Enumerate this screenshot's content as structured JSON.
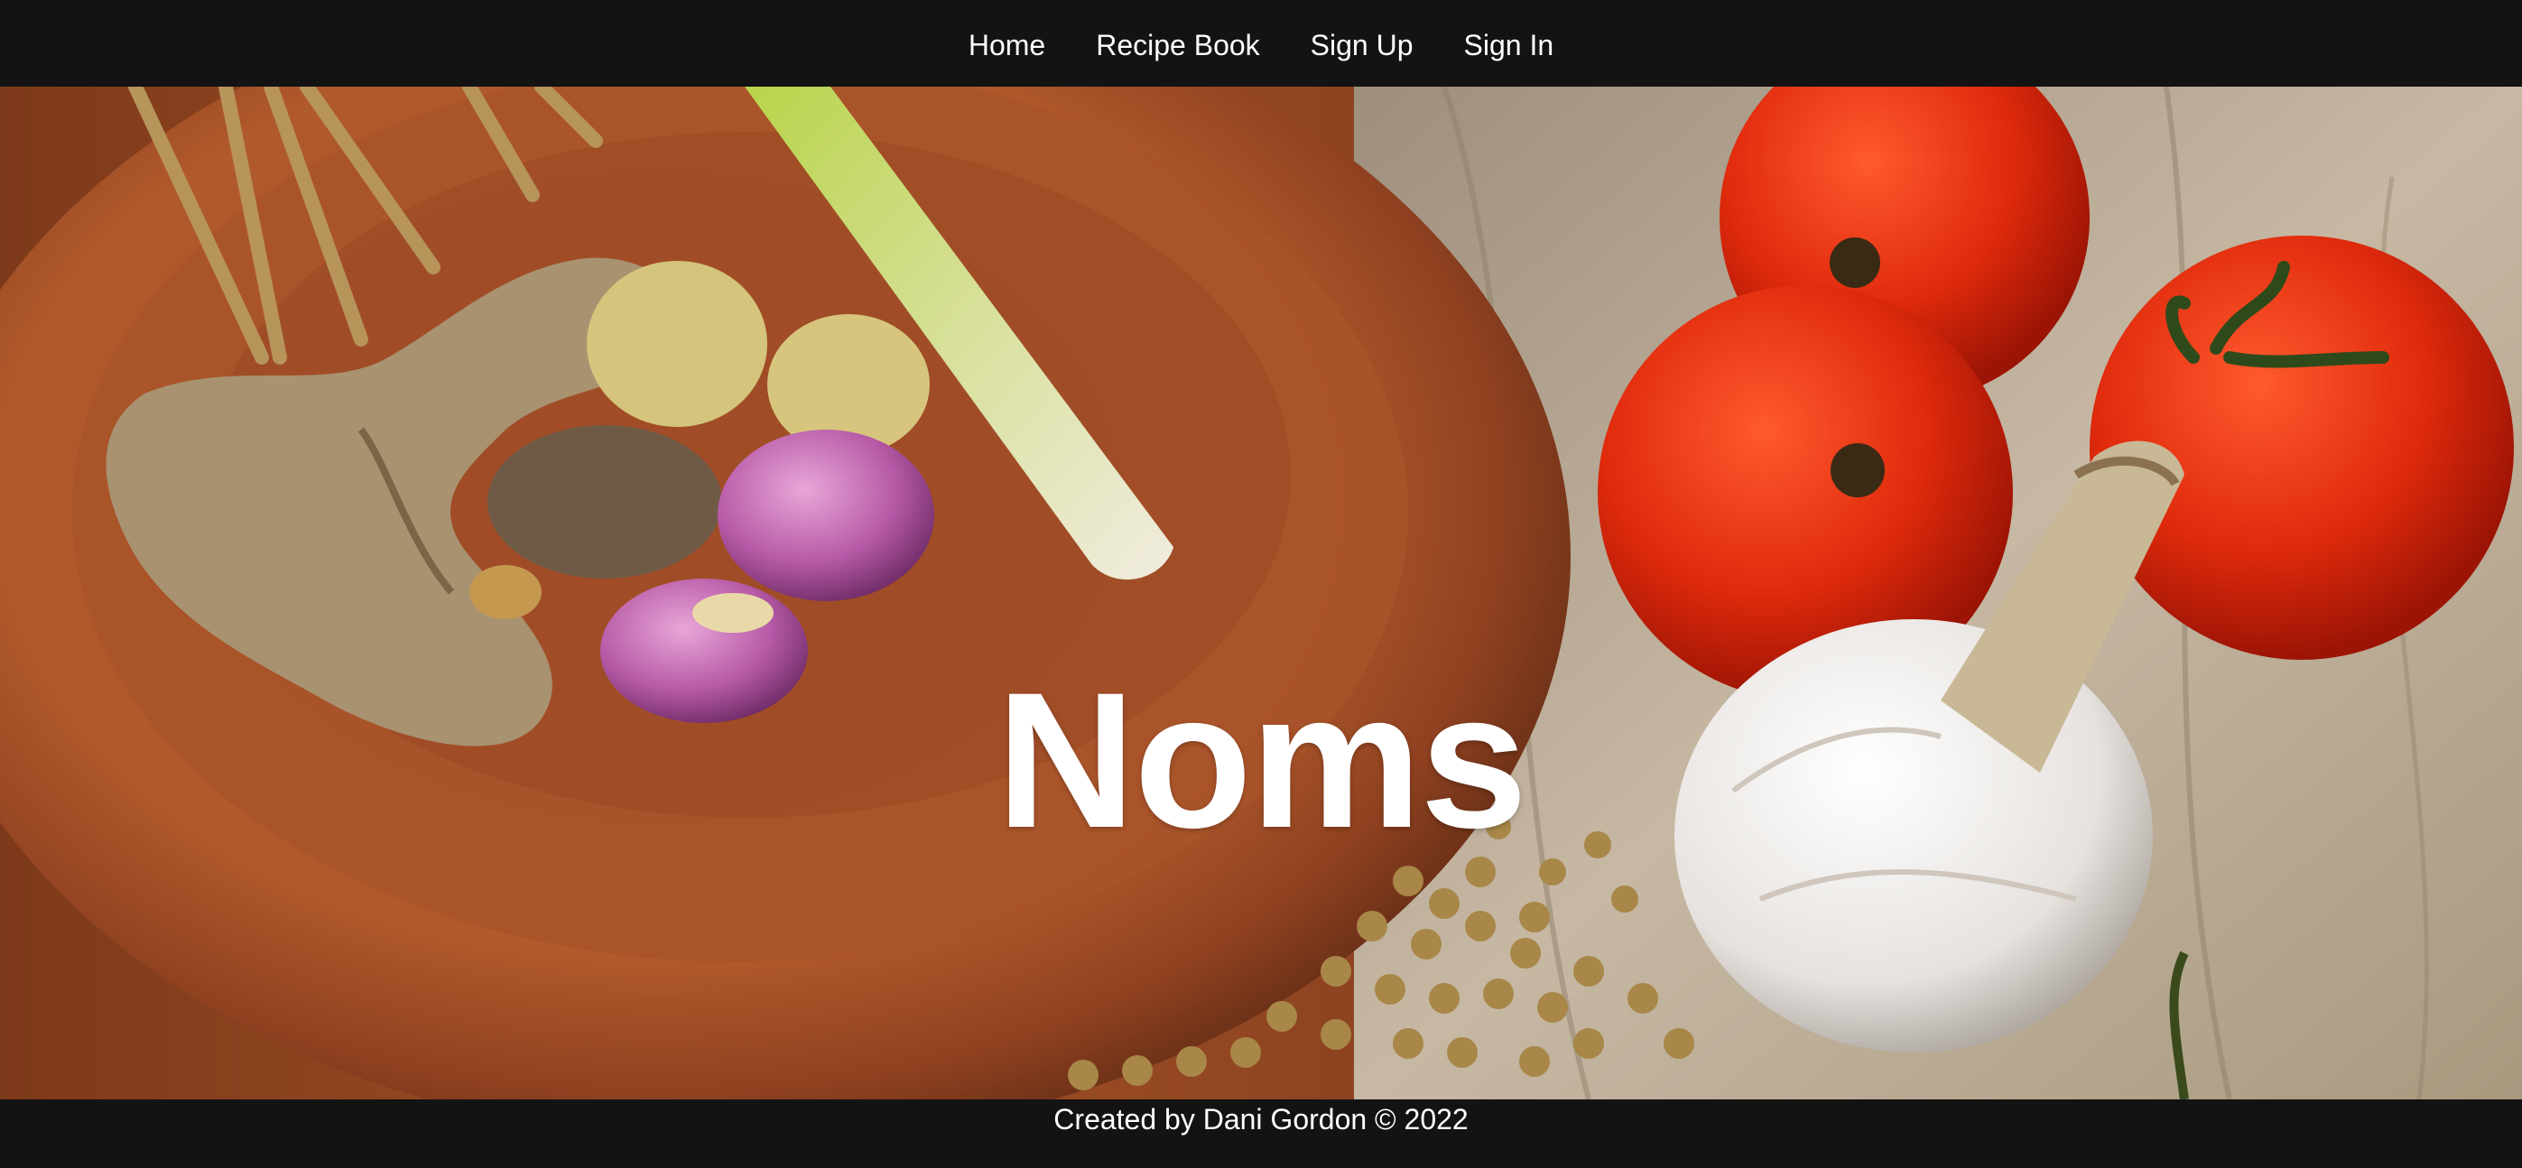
{
  "nav": {
    "links": [
      {
        "label": "Home"
      },
      {
        "label": "Recipe Book"
      },
      {
        "label": "Sign Up"
      },
      {
        "label": "Sign In"
      }
    ]
  },
  "hero": {
    "title": "Noms",
    "image_icon": "food-ingredients-image"
  },
  "footer": {
    "text": "Created by Dani Gordon © 2022"
  },
  "colors": {
    "nav_background": "#131313",
    "text": "#ffffff"
  }
}
